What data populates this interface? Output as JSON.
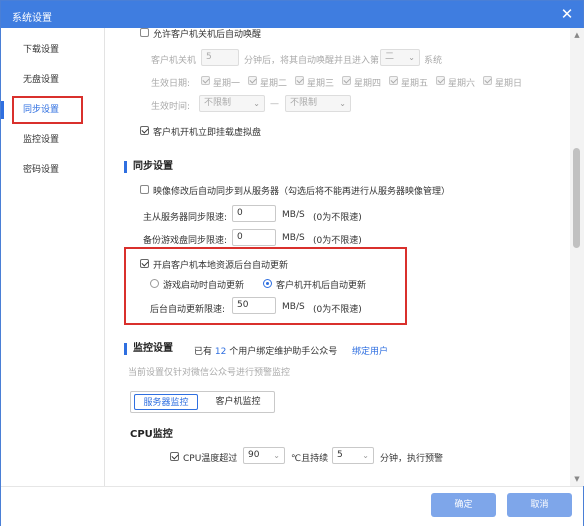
{
  "window": {
    "title": "系统设置",
    "close_glyph": "✕"
  },
  "sidebar": {
    "items": [
      {
        "label": "下载设置"
      },
      {
        "label": "无盘设置"
      },
      {
        "label": "同步设置"
      },
      {
        "label": "监控设置"
      },
      {
        "label": "密码设置"
      }
    ],
    "active_index": 2
  },
  "diskless": {
    "auto_wake": {
      "label": "允许客户机关机后自动唤醒",
      "checked": false
    },
    "client_off_prefix": "客户机关机",
    "client_off_minutes": "5",
    "client_off_mid": "分钟后，将其自动唤醒并且进入第",
    "boot_option": "二",
    "boot_suffix": "系统",
    "effective_date_label": "生效日期:",
    "weekdays": [
      "星期一",
      "星期二",
      "星期三",
      "星期四",
      "星期五",
      "星期六",
      "星期日"
    ],
    "effective_time_label": "生效时间:",
    "time_from": "不限制",
    "time_sep": "—",
    "time_to": "不限制",
    "mount_virtual": {
      "label": "客户机开机立即挂载虚拟盘",
      "checked": true
    }
  },
  "sync": {
    "title": "同步设置",
    "image_sync": {
      "label": "映像修改后自动同步到从服务器（勾选后将不能再进行从服务器映像管理）",
      "checked": false
    },
    "master_slave_label": "主从服务器同步限速:",
    "master_slave_value": "0",
    "game_disk_label": "备份游戏盘同步限速:",
    "game_disk_value": "0",
    "unit": "MB/S",
    "no_limit_hint": "(0为不限速)",
    "local_update": {
      "label": "开启客户机本地资源后台自动更新",
      "checked": true
    },
    "radio_game": "游戏启动时自动更新",
    "radio_boot": "客户机开机后自动更新",
    "bg_limit_label": "后台自动更新限速:",
    "bg_limit_value": "50"
  },
  "monitor": {
    "title": "监控设置",
    "bound_prefix": "已有",
    "bound_count": "12",
    "bound_suffix": "个用户绑定维护助手公众号",
    "unbind_link": "绑定用户",
    "desc": "当前设置仅针对微信公众号进行预警监控",
    "tabs": [
      "服务器监控",
      "客户机监控"
    ],
    "cpu_title": "CPU监控",
    "cpu_temp": {
      "label": "CPU温度超过",
      "checked": true
    },
    "cpu_temp_value": "90",
    "cpu_duration_label": "℃且持续",
    "cpu_duration_value": "5",
    "cpu_action": "分钟，执行预警"
  },
  "footer": {
    "ok": "确定",
    "cancel": "取消"
  }
}
